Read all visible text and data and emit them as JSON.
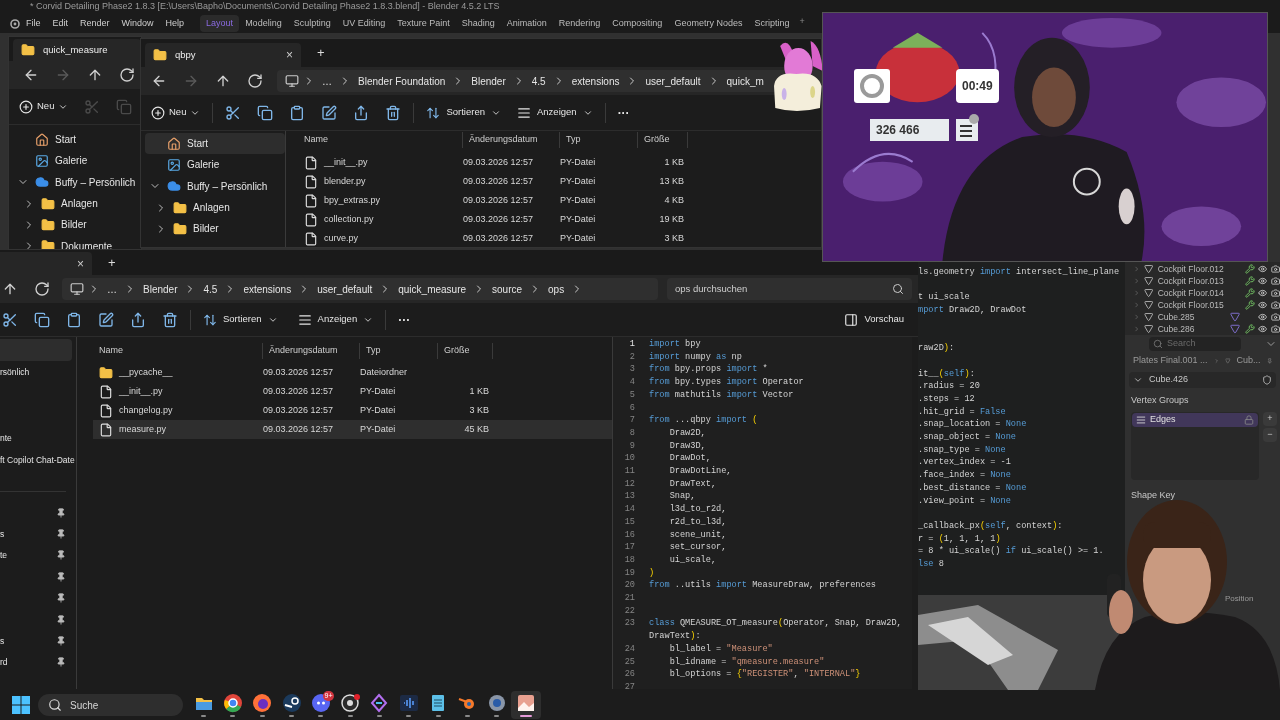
{
  "blender": {
    "title": "* Corvid Detailing Phase2 1.8.3 [E:\\Users\\Bapho\\Documents\\Corvid Detailing Phase2 1.8.3.blend] - Blender 4.5.2 LTS",
    "menu": [
      "File",
      "Edit",
      "Render",
      "Window",
      "Help"
    ],
    "workspaces": [
      {
        "label": "Layout",
        "selected": true
      },
      {
        "label": "Modeling",
        "selected": false
      },
      {
        "label": "Sculpting",
        "selected": false
      },
      {
        "label": "UV Editing",
        "selected": false
      },
      {
        "label": "Texture Paint",
        "selected": false
      },
      {
        "label": "Shading",
        "selected": false
      },
      {
        "label": "Animation",
        "selected": false
      },
      {
        "label": "Rendering",
        "selected": false
      },
      {
        "label": "Compositing",
        "selected": false
      },
      {
        "label": "Geometry Nodes",
        "selected": false
      },
      {
        "label": "Scripting",
        "selected": false
      }
    ],
    "add_workspace": "+",
    "code": [
      {
        "kind": "code",
        "segs": [
          {
            "text": "ls.geometry ",
            "kind": "tx"
          },
          {
            "text": "import",
            "kind": "kw"
          },
          {
            "text": " intersect_line_plane",
            "kind": "tx"
          }
        ]
      },
      {
        "kind": "blank"
      },
      {
        "kind": "code",
        "segs": [
          {
            "text": "t ui_scale",
            "kind": "tx"
          }
        ]
      },
      {
        "kind": "code",
        "segs": [
          {
            "text": "mport",
            "kind": "kw"
          },
          {
            "text": " Draw2D, DrawDot",
            "kind": "tx"
          }
        ]
      },
      {
        "kind": "blank"
      },
      {
        "kind": "blank"
      },
      {
        "kind": "code",
        "segs": [
          {
            "text": "raw2D",
            "kind": "tx"
          },
          {
            "text": ")",
            "kind": "br"
          },
          {
            "text": ":",
            "kind": "tx"
          }
        ]
      },
      {
        "kind": "blank"
      },
      {
        "kind": "code",
        "segs": [
          {
            "text": "it__",
            "kind": "tx"
          },
          {
            "text": "(",
            "kind": "br"
          },
          {
            "text": "self",
            "kind": "kw"
          },
          {
            "text": ")",
            "kind": "br"
          },
          {
            "text": ":",
            "kind": "tx"
          }
        ]
      },
      {
        "kind": "code",
        "segs": [
          {
            "text": ".radius = 20",
            "kind": "tx"
          }
        ]
      },
      {
        "kind": "code",
        "segs": [
          {
            "text": ".steps = 12",
            "kind": "tx"
          }
        ]
      },
      {
        "kind": "code",
        "segs": [
          {
            "text": ".hit_grid = ",
            "kind": "tx"
          },
          {
            "text": "False",
            "kind": "kw"
          }
        ]
      },
      {
        "kind": "code",
        "segs": [
          {
            "text": ".snap_location = ",
            "kind": "tx"
          },
          {
            "text": "None",
            "kind": "kw"
          }
        ]
      },
      {
        "kind": "code",
        "segs": [
          {
            "text": ".snap_object = ",
            "kind": "tx"
          },
          {
            "text": "None",
            "kind": "kw"
          }
        ]
      },
      {
        "kind": "code",
        "segs": [
          {
            "text": ".snap_type = ",
            "kind": "tx"
          },
          {
            "text": "None",
            "kind": "kw"
          }
        ]
      },
      {
        "kind": "code",
        "segs": [
          {
            "text": ".vertex_index = -1",
            "kind": "tx"
          }
        ]
      },
      {
        "kind": "code",
        "segs": [
          {
            "text": ".face_index = ",
            "kind": "tx"
          },
          {
            "text": "None",
            "kind": "kw"
          }
        ]
      },
      {
        "kind": "code",
        "segs": [
          {
            "text": ".best_distance = ",
            "kind": "tx"
          },
          {
            "text": "None",
            "kind": "kw"
          }
        ]
      },
      {
        "kind": "code",
        "segs": [
          {
            "text": ".view_point = ",
            "kind": "tx"
          },
          {
            "text": "None",
            "kind": "kw"
          }
        ]
      },
      {
        "kind": "blank"
      },
      {
        "kind": "code",
        "segs": [
          {
            "text": "_callback_px",
            "kind": "tx"
          },
          {
            "text": "(",
            "kind": "br"
          },
          {
            "text": "self",
            "kind": "kw"
          },
          {
            "text": ", context",
            "kind": "tx"
          },
          {
            "text": ")",
            "kind": "br"
          },
          {
            "text": ":",
            "kind": "tx"
          }
        ]
      },
      {
        "kind": "code",
        "segs": [
          {
            "text": "r = ",
            "kind": "tx"
          },
          {
            "text": "(",
            "kind": "br"
          },
          {
            "text": "1, 1, 1, 1",
            "kind": "tx"
          },
          {
            "text": ")",
            "kind": "br"
          }
        ]
      },
      {
        "kind": "code",
        "segs": [
          {
            "text": "= 8 * ui_scale() ",
            "kind": "tx"
          },
          {
            "text": "if",
            "kind": "kw"
          },
          {
            "text": " ui_scale() >= 1.",
            "kind": "tx"
          }
        ]
      },
      {
        "kind": "code",
        "segs": [
          {
            "text": "lse",
            "kind": "kw"
          },
          {
            "text": " 8",
            "kind": "tx"
          }
        ]
      }
    ],
    "outliner": [
      {
        "name": "Cockpit Floor.012",
        "modifier": true,
        "mesh_data": false
      },
      {
        "name": "Cockpit Floor.013",
        "modifier": true,
        "mesh_data": false
      },
      {
        "name": "Cockpit Floor.014",
        "modifier": true,
        "mesh_data": false
      },
      {
        "name": "Cockpit Floor.015",
        "modifier": true,
        "mesh_data": false
      },
      {
        "name": "Cube.285",
        "modifier": false,
        "mesh_data": true
      },
      {
        "name": "Cube.286",
        "modifier": true,
        "mesh_data": true
      }
    ],
    "properties": {
      "search": {
        "placeholder": "Search"
      },
      "breadcrumb": [
        "Plates Final.001 ...",
        "Cub..."
      ],
      "object": "Cube.426",
      "vertex_groups": {
        "title": "Vertex Groups",
        "items": [
          {
            "name": "Edges",
            "selected": true
          }
        ],
        "add": "+",
        "remove": "−"
      },
      "shape_keys": {
        "title": "Shape Key"
      },
      "footer": "Position"
    }
  },
  "explorer_back": {
    "tab": "quick_measure",
    "nav": [
      {
        "kind": "back",
        "disabled": false
      },
      {
        "kind": "forward",
        "disabled": true
      },
      {
        "kind": "up",
        "disabled": false
      },
      {
        "kind": "refresh",
        "disabled": false
      }
    ],
    "new_button": "Neu",
    "tools": [
      {
        "kind": "cut",
        "disabled": true
      },
      {
        "kind": "copy",
        "disabled": true
      }
    ],
    "sidebar": [
      {
        "label": "Start",
        "kind": "home",
        "selected": false
      },
      {
        "label": "Galerie",
        "kind": "gallery",
        "selected": false
      },
      {
        "label": "Buffy – Persönlich",
        "kind": "cloud",
        "selected": false,
        "expanded": true,
        "children": [
          {
            "label": "Anlagen",
            "kind": "folder",
            "selected": false,
            "expanded": false
          },
          {
            "label": "Bilder",
            "kind": "folder",
            "selected": false,
            "expanded": false
          },
          {
            "label": "Dokumente",
            "kind": "folder",
            "selected": false,
            "expanded": false
          }
        ]
      }
    ]
  },
  "explorer_qbpy": {
    "tab": "qbpy",
    "close": "×",
    "new_tab": "+",
    "nav": [
      {
        "kind": "back",
        "disabled": false
      },
      {
        "kind": "forward",
        "disabled": true
      },
      {
        "kind": "up",
        "disabled": false
      },
      {
        "kind": "refresh",
        "disabled": false
      }
    ],
    "breadcrumb": [
      "…",
      "Blender Foundation",
      "Blender",
      "4.5",
      "extensions",
      "user_default",
      "quick_m"
    ],
    "new_button": "Neu",
    "tools": [
      {
        "kind": "cut",
        "disabled": false
      },
      {
        "kind": "copy",
        "disabled": false
      },
      {
        "kind": "paste",
        "disabled": false
      },
      {
        "kind": "rename",
        "disabled": false
      },
      {
        "kind": "share",
        "disabled": false
      },
      {
        "kind": "delete",
        "disabled": false
      }
    ],
    "sort": "Sortieren",
    "view": "Anzeigen",
    "more": "···",
    "sidebar": [
      {
        "label": "Start",
        "kind": "home",
        "selected": true
      },
      {
        "label": "Galerie",
        "kind": "gallery",
        "selected": false
      },
      {
        "label": "Buffy – Persönlich",
        "kind": "cloud",
        "selected": false,
        "expanded": true,
        "children": [
          {
            "label": "Anlagen",
            "kind": "folder",
            "selected": false,
            "expanded": false
          },
          {
            "label": "Bilder",
            "kind": "folder",
            "selected": false,
            "expanded": false
          }
        ]
      }
    ],
    "columns": [
      "Name",
      "Änderungsdatum",
      "Typ",
      "Größe"
    ],
    "files": [
      {
        "name": "__init__.py",
        "kind": "file",
        "date": "09.03.2026 12:57",
        "type": "PY-Datei",
        "size": "1 KB",
        "selected": false
      },
      {
        "name": "blender.py",
        "kind": "file",
        "date": "09.03.2026 12:57",
        "type": "PY-Datei",
        "size": "13 KB",
        "selected": false
      },
      {
        "name": "bpy_extras.py",
        "kind": "file",
        "date": "09.03.2026 12:57",
        "type": "PY-Datei",
        "size": "4 KB",
        "selected": false
      },
      {
        "name": "collection.py",
        "kind": "file",
        "date": "09.03.2026 12:57",
        "type": "PY-Datei",
        "size": "19 KB",
        "selected": false
      },
      {
        "name": "curve.py",
        "kind": "file",
        "date": "09.03.2026 12:57",
        "type": "PY-Datei",
        "size": "3 KB",
        "selected": false
      }
    ]
  },
  "explorer_ops": {
    "close": "×",
    "new_tab": "+",
    "nav": [
      {
        "kind": "up",
        "disabled": false
      },
      {
        "kind": "refresh",
        "disabled": false
      }
    ],
    "breadcrumb": [
      "…",
      "Blender",
      "4.5",
      "extensions",
      "user_default",
      "quick_measure",
      "source",
      "ops"
    ],
    "search": {
      "placeholder": "ops durchsuchen"
    },
    "tools": [
      {
        "kind": "cut",
        "disabled": false
      },
      {
        "kind": "copy",
        "disabled": false
      },
      {
        "kind": "paste",
        "disabled": false
      },
      {
        "kind": "rename",
        "disabled": false
      },
      {
        "kind": "share",
        "disabled": false
      },
      {
        "kind": "delete",
        "disabled": false
      }
    ],
    "sort": "Sortieren",
    "view": "Anzeigen",
    "more": "···",
    "preview": "Vorschau",
    "sidebar": [
      {
        "selected": true
      },
      {
        "label": "rsönlich",
        "selected": false
      },
      {
        "label": "nte",
        "selected": false
      },
      {
        "label": "ft Copilot Chat-Date",
        "selected": false
      }
    ],
    "quick_access": [
      {
        "pinned": true
      },
      {
        "label": "s",
        "pinned": true
      },
      {
        "label": "te",
        "pinned": true
      },
      {
        "pinned": true
      },
      {
        "pinned": true
      },
      {
        "pinned": true
      },
      {
        "label": "s",
        "pinned": true
      },
      {
        "label": "rd",
        "pinned": true
      }
    ],
    "columns": [
      "Name",
      "Änderungsdatum",
      "Typ",
      "Größe"
    ],
    "files": [
      {
        "name": "__pycache__",
        "kind": "folder",
        "date": "09.03.2026 12:57",
        "type": "Dateiordner",
        "selected": false
      },
      {
        "name": "__init__.py",
        "kind": "file",
        "date": "09.03.2026 12:57",
        "type": "PY-Datei",
        "size": "1 KB",
        "selected": false
      },
      {
        "name": "changelog.py",
        "kind": "file",
        "date": "09.03.2026 12:57",
        "type": "PY-Datei",
        "size": "3 KB",
        "selected": false
      },
      {
        "name": "measure.py",
        "kind": "file",
        "date": "09.03.2026 12:57",
        "type": "PY-Datei",
        "size": "45 KB",
        "selected": true
      }
    ],
    "code": [
      {
        "n": "1",
        "current": true,
        "segs": [
          {
            "text": "import",
            "kind": "kw"
          },
          {
            "text": " bpy",
            "kind": "tx"
          }
        ]
      },
      {
        "n": "2",
        "current": false,
        "segs": [
          {
            "text": "import",
            "kind": "kw"
          },
          {
            "text": " numpy ",
            "kind": "tx"
          },
          {
            "text": "as",
            "kind": "kw"
          },
          {
            "text": " np",
            "kind": "tx"
          }
        ]
      },
      {
        "n": "3",
        "current": false,
        "segs": [
          {
            "text": "from",
            "kind": "kw"
          },
          {
            "text": " bpy.props ",
            "kind": "tx"
          },
          {
            "text": "import",
            "kind": "kw"
          },
          {
            "text": " *",
            "kind": "tx"
          }
        ]
      },
      {
        "n": "4",
        "current": false,
        "segs": [
          {
            "text": "from",
            "kind": "kw"
          },
          {
            "text": " bpy.types ",
            "kind": "tx"
          },
          {
            "text": "import",
            "kind": "kw"
          },
          {
            "text": " Operator",
            "kind": "tx"
          }
        ]
      },
      {
        "n": "5",
        "current": false,
        "segs": [
          {
            "text": "from",
            "kind": "kw"
          },
          {
            "text": " mathutils ",
            "kind": "tx"
          },
          {
            "text": "import",
            "kind": "kw"
          },
          {
            "text": " Vector",
            "kind": "tx"
          }
        ]
      },
      {
        "n": "6",
        "current": false
      },
      {
        "n": "7",
        "current": false,
        "segs": [
          {
            "text": "from",
            "kind": "kw"
          },
          {
            "text": " ...qbpy ",
            "kind": "tx"
          },
          {
            "text": "import",
            "kind": "kw"
          },
          {
            "text": " (",
            "kind": "br"
          }
        ]
      },
      {
        "n": "8",
        "current": false,
        "segs": [
          {
            "text": "    Draw2D,",
            "kind": "tx"
          }
        ]
      },
      {
        "n": "9",
        "current": false,
        "segs": [
          {
            "text": "    Draw3D,",
            "kind": "tx"
          }
        ]
      },
      {
        "n": "10",
        "current": false,
        "segs": [
          {
            "text": "    DrawDot,",
            "kind": "tx"
          }
        ]
      },
      {
        "n": "11",
        "current": false,
        "segs": [
          {
            "text": "    DrawDotLine,",
            "kind": "tx"
          }
        ]
      },
      {
        "n": "12",
        "current": false,
        "segs": [
          {
            "text": "    DrawText,",
            "kind": "tx"
          }
        ]
      },
      {
        "n": "13",
        "current": false,
        "segs": [
          {
            "text": "    Snap,",
            "kind": "tx"
          }
        ]
      },
      {
        "n": "14",
        "current": false,
        "segs": [
          {
            "text": "    l3d_to_r2d,",
            "kind": "tx"
          }
        ]
      },
      {
        "n": "15",
        "current": false,
        "segs": [
          {
            "text": "    r2d_to_l3d,",
            "kind": "tx"
          }
        ]
      },
      {
        "n": "16",
        "current": false,
        "segs": [
          {
            "text": "    scene_unit,",
            "kind": "tx"
          }
        ]
      },
      {
        "n": "17",
        "current": false,
        "segs": [
          {
            "text": "    set_cursor,",
            "kind": "tx"
          }
        ]
      },
      {
        "n": "18",
        "current": false,
        "segs": [
          {
            "text": "    ui_scale,",
            "kind": "tx"
          }
        ]
      },
      {
        "n": "19",
        "current": false,
        "segs": [
          {
            "text": ")",
            "kind": "br"
          }
        ]
      },
      {
        "n": "20",
        "current": false,
        "segs": [
          {
            "text": "from",
            "kind": "kw"
          },
          {
            "text": " ..utils ",
            "kind": "tx"
          },
          {
            "text": "import",
            "kind": "kw"
          },
          {
            "text": " MeasureDraw, preferences",
            "kind": "tx"
          }
        ]
      },
      {
        "n": "21",
        "current": false
      },
      {
        "n": "22",
        "current": false
      },
      {
        "n": "23",
        "current": false,
        "segs": [
          {
            "text": "class",
            "kind": "kw"
          },
          {
            "text": " QMEASURE_OT_measure",
            "kind": "tx"
          },
          {
            "text": "(",
            "kind": "br"
          },
          {
            "text": "Operator, Snap, Draw2D,",
            "kind": "tx"
          }
        ]
      },
      {
        "segs": [
          {
            "text": "DrawText",
            "kind": "tx"
          },
          {
            "text": ")",
            "kind": "br"
          },
          {
            "text": ":",
            "kind": "tx"
          }
        ]
      },
      {
        "n": "24",
        "current": false,
        "segs": [
          {
            "text": "    bl_label = ",
            "kind": "tx"
          },
          {
            "text": "\"Measure\"",
            "kind": "str"
          }
        ]
      },
      {
        "n": "25",
        "current": false,
        "segs": [
          {
            "text": "    bl_idname = ",
            "kind": "tx"
          },
          {
            "text": "\"qmeasure.measure\"",
            "kind": "str"
          }
        ]
      },
      {
        "n": "26",
        "current": false,
        "segs": [
          {
            "text": "    bl_options = ",
            "kind": "tx"
          },
          {
            "text": "{",
            "kind": "br"
          },
          {
            "text": "\"REGISTER\"",
            "kind": "str"
          },
          {
            "text": ", ",
            "kind": "tx"
          },
          {
            "text": "\"INTERNAL\"",
            "kind": "str"
          },
          {
            "text": "}",
            "kind": "br"
          }
        ]
      },
      {
        "n": "27",
        "current": false
      }
    ]
  },
  "stream_overlay": {
    "timer": "00:49",
    "counter": "326 466"
  },
  "taskbar": {
    "search": {
      "placeholder": "Suche"
    },
    "apps": [
      {
        "kind": "folder",
        "active": false
      },
      {
        "kind": "chrome",
        "active": false
      },
      {
        "kind": "firefox",
        "active": false
      },
      {
        "kind": "steam",
        "active": false
      },
      {
        "kind": "discord",
        "active": false,
        "badge": "9+"
      },
      {
        "kind": "obs",
        "active": false,
        "alert": true
      },
      {
        "kind": "diamond",
        "active": false
      },
      {
        "kind": "audio",
        "active": false
      },
      {
        "kind": "notepad",
        "active": false
      },
      {
        "kind": "blender",
        "active": false
      },
      {
        "kind": "settings",
        "active": false
      },
      {
        "kind": "paint",
        "active": true
      }
    ]
  }
}
